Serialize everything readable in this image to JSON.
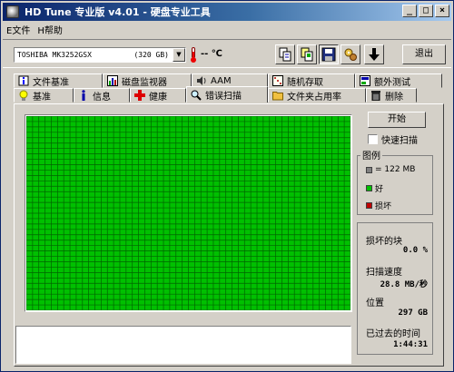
{
  "window": {
    "title": "HD Tune 专业版 v4.01 - 硬盘专业工具",
    "minimize": "_",
    "maximize": "□",
    "close": "×"
  },
  "menu": [
    {
      "label": "E文件"
    },
    {
      "label": "H帮助"
    }
  ],
  "toolbar": {
    "drive_model": "TOSHIBA MK3252GSX",
    "drive_size": "(320 GB)",
    "temperature": "-- ℃",
    "exit_label": "退出"
  },
  "tabs_back": [
    {
      "label": "文件基准",
      "icon": "info-icon"
    },
    {
      "label": "磁盘监视器",
      "icon": "chart-icon"
    },
    {
      "label": "AAM",
      "icon": "speaker-icon"
    },
    {
      "label": "随机存取",
      "icon": "dice-icon"
    },
    {
      "label": "额外测试",
      "icon": "tests-icon"
    }
  ],
  "tabs_front": [
    {
      "label": "基准",
      "icon": "lightbulb-icon"
    },
    {
      "label": "信息",
      "icon": "info-icon"
    },
    {
      "label": "健康",
      "icon": "health-cross-icon"
    },
    {
      "label": "错误扫描",
      "icon": "magnifier-icon"
    },
    {
      "label": "文件夹占用率",
      "icon": "folder-icon"
    },
    {
      "label": "删除",
      "icon": "trash-icon"
    }
  ],
  "scan": {
    "start_label": "开始",
    "quick_scan_label": "快速扫描",
    "quick_scan_checked": false,
    "grid_color": "#00c000",
    "grid_line_color": "#006400"
  },
  "legend": {
    "title": "图例",
    "block_size": "= 122 MB",
    "good": "好",
    "bad": "损坏",
    "colors": {
      "block": "#808080",
      "good": "#00c000",
      "bad": "#c00000"
    }
  },
  "stats": {
    "damaged_label": "损坏的块",
    "damaged_value": "0.0 %",
    "speed_label": "扫描速度",
    "speed_value": "28.8 MB/秒",
    "position_label": "位置",
    "position_value": "297 GB",
    "elapsed_label": "已过去的时间",
    "elapsed_value": "1:44:31"
  }
}
